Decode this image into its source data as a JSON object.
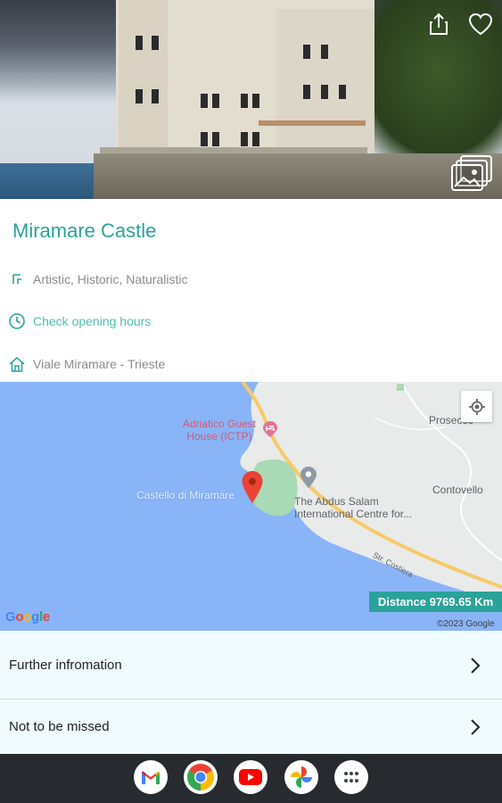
{
  "hero": {
    "share_icon": "share-icon",
    "favorite_icon": "heart-outline-icon",
    "gallery_icon": "photo-gallery-icon"
  },
  "place": {
    "title": "Miramare Castle",
    "categories": "Artistic, Historic, Naturalistic",
    "hours_link": "Check opening hours",
    "address": "Viale Miramare  - Trieste"
  },
  "map": {
    "labels": {
      "prosecco": "Prosecco",
      "contovello": "Contovello",
      "guest_house": "Adriatico Guest\nHouse (ICTP)",
      "castello": "Castello di Miramare",
      "abdus_salam": "The Abdus Salam\nInternational Centre for...",
      "road": "Str. Costiera"
    },
    "distance": "Distance 9769.65 Km",
    "google": "Google",
    "copyright": "©2023 Google"
  },
  "list": [
    {
      "label": "Further infromation"
    },
    {
      "label": "Not to be missed"
    }
  ],
  "dock": [
    {
      "name": "Gmail"
    },
    {
      "name": "Chrome"
    },
    {
      "name": "YouTube"
    },
    {
      "name": "Photos"
    },
    {
      "name": "App drawer"
    }
  ],
  "colors": {
    "accent": "#2aa29a",
    "accent_light": "#4fbfb4",
    "list_bg": "#f0fbfd",
    "water": "#8ab4f8",
    "park": "#a8dab5",
    "road": "#f8c967"
  }
}
